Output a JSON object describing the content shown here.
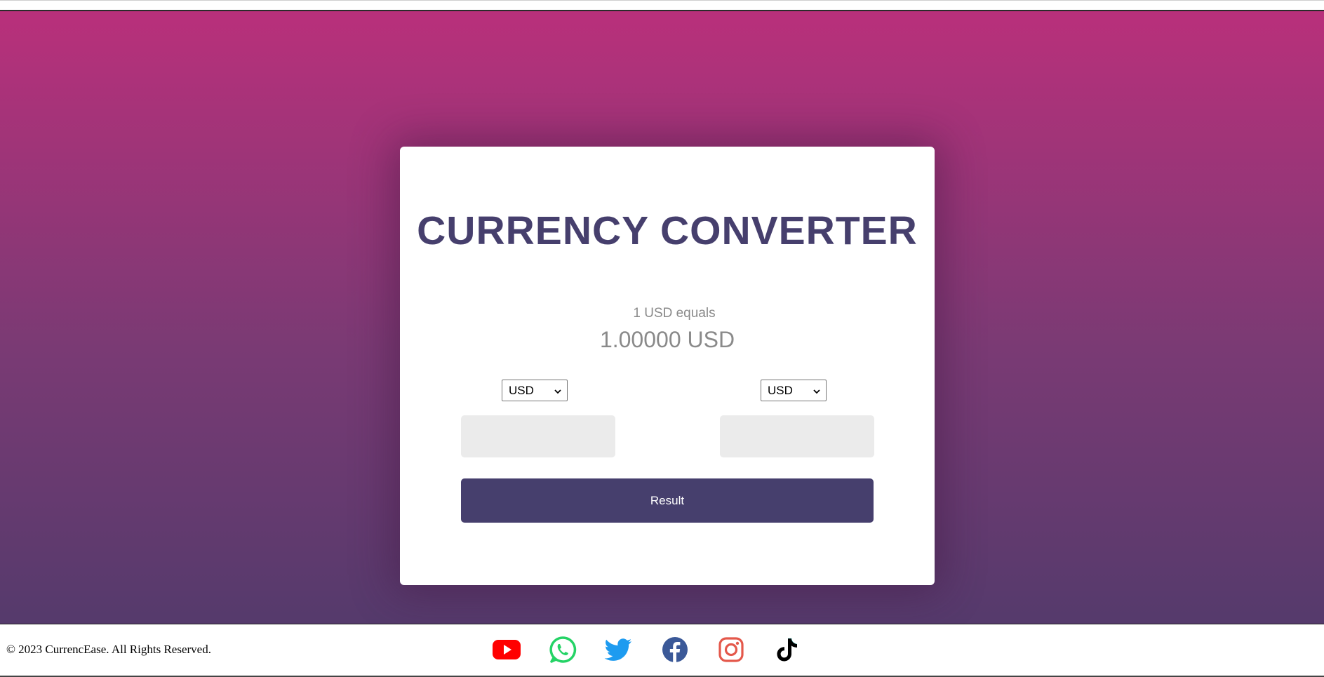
{
  "card": {
    "title": "CURRENCY CONVERTER",
    "rate_label": "1 USD equals",
    "rate_value": "1.00000 USD",
    "from_currency": "USD",
    "to_currency": "USD",
    "from_amount": "",
    "to_amount": "",
    "result_label": "Result"
  },
  "footer": {
    "copyright": "© 2023 CurrencEase. All Rights Reserved.",
    "social_icons": [
      "youtube-icon",
      "whatsapp-icon",
      "twitter-icon",
      "facebook-icon",
      "instagram-icon",
      "tiktok-icon"
    ]
  },
  "colors": {
    "gradient_top": "#b9307b",
    "gradient_bottom": "#553a6c",
    "accent": "#463f6d",
    "youtube": "#ff0000",
    "whatsapp": "#25d366",
    "twitter": "#1d9bf0",
    "facebook": "#3b5998",
    "instagram": "#e4584b",
    "tiktok": "#000000"
  }
}
